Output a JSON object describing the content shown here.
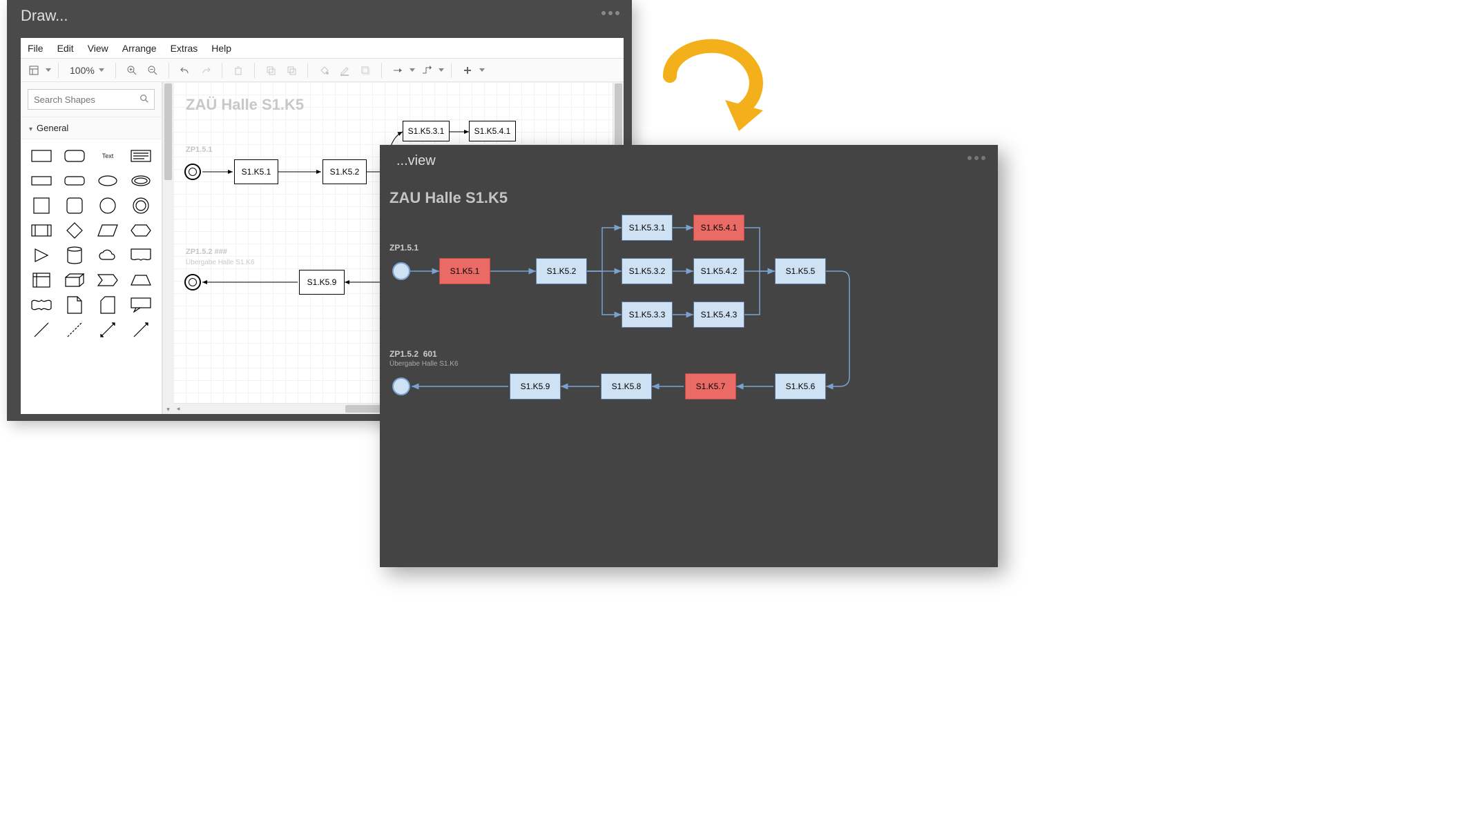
{
  "draw": {
    "title": "Draw...",
    "menubar": [
      "File",
      "Edit",
      "View",
      "Arrange",
      "Extras",
      "Help"
    ],
    "zoom": "100%",
    "search_placeholder": "Search Shapes",
    "palette_section": "General",
    "shape_text_label": "Text",
    "canvas": {
      "title": "ZAÜ Halle S1.K5",
      "zp1": "ZP1.5.1",
      "zp2": "ZP1.5.2   ###",
      "zp2_sub": "Übergabe Halle S1.K6",
      "nodes": {
        "n1": "S1.K5.1",
        "n2": "S1.K5.2",
        "n31": "S1.K5.3.1",
        "n41": "S1.K5.4.1",
        "n9": "S1.K5.9"
      }
    }
  },
  "view": {
    "title": "...view",
    "heading": "ZAU Halle S1.K5",
    "zp1": "ZP1.5.1",
    "zp2": "ZP1.5.2",
    "zp2_num": "601",
    "zp2_sub": "Übergabe Halle S1.K6",
    "nodes": {
      "n1": "S1.K5.1",
      "n2": "S1.K5.2",
      "n31": "S1.K5.3.1",
      "n41": "S1.K5.4.1",
      "n32": "S1.K5.3.2",
      "n42": "S1.K5.4.2",
      "n33": "S1.K5.3.3",
      "n43": "S1.K5.4.3",
      "n5": "S1.K5.5",
      "n6": "S1.K5.6",
      "n7": "S1.K5.7",
      "n8": "S1.K5.8",
      "n9": "S1.K5.9"
    }
  },
  "chart_data": {
    "type": "flow-diagram",
    "title": "ZAU Halle S1.K5",
    "lanes": [
      {
        "label": "ZP1.5.1",
        "sublabel": null
      },
      {
        "label": "ZP1.5.2 601",
        "sublabel": "Übergabe Halle S1.K6"
      }
    ],
    "nodes": [
      {
        "id": "start1",
        "type": "start",
        "lane": 0
      },
      {
        "id": "S1.K5.1",
        "type": "task",
        "lane": 0,
        "status": "alert"
      },
      {
        "id": "S1.K5.2",
        "type": "task",
        "lane": 0,
        "status": "normal"
      },
      {
        "id": "S1.K5.3.1",
        "type": "task",
        "lane": 0,
        "status": "normal"
      },
      {
        "id": "S1.K5.4.1",
        "type": "task",
        "lane": 0,
        "status": "alert"
      },
      {
        "id": "S1.K5.3.2",
        "type": "task",
        "lane": 0,
        "status": "normal"
      },
      {
        "id": "S1.K5.4.2",
        "type": "task",
        "lane": 0,
        "status": "normal"
      },
      {
        "id": "S1.K5.3.3",
        "type": "task",
        "lane": 0,
        "status": "normal"
      },
      {
        "id": "S1.K5.4.3",
        "type": "task",
        "lane": 0,
        "status": "normal"
      },
      {
        "id": "S1.K5.5",
        "type": "task",
        "lane": 0,
        "status": "normal"
      },
      {
        "id": "S1.K5.6",
        "type": "task",
        "lane": 1,
        "status": "normal"
      },
      {
        "id": "S1.K5.7",
        "type": "task",
        "lane": 1,
        "status": "alert"
      },
      {
        "id": "S1.K5.8",
        "type": "task",
        "lane": 1,
        "status": "normal"
      },
      {
        "id": "S1.K5.9",
        "type": "task",
        "lane": 1,
        "status": "normal"
      },
      {
        "id": "end2",
        "type": "end",
        "lane": 1
      }
    ],
    "edges": [
      [
        "start1",
        "S1.K5.1"
      ],
      [
        "S1.K5.1",
        "S1.K5.2"
      ],
      [
        "S1.K5.2",
        "S1.K5.3.1"
      ],
      [
        "S1.K5.2",
        "S1.K5.3.2"
      ],
      [
        "S1.K5.2",
        "S1.K5.3.3"
      ],
      [
        "S1.K5.3.1",
        "S1.K5.4.1"
      ],
      [
        "S1.K5.3.2",
        "S1.K5.4.2"
      ],
      [
        "S1.K5.3.3",
        "S1.K5.4.3"
      ],
      [
        "S1.K5.4.1",
        "S1.K5.5"
      ],
      [
        "S1.K5.4.2",
        "S1.K5.5"
      ],
      [
        "S1.K5.4.3",
        "S1.K5.5"
      ],
      [
        "S1.K5.5",
        "S1.K5.6"
      ],
      [
        "S1.K5.6",
        "S1.K5.7"
      ],
      [
        "S1.K5.7",
        "S1.K5.8"
      ],
      [
        "S1.K5.8",
        "S1.K5.9"
      ],
      [
        "S1.K5.9",
        "end2"
      ]
    ],
    "status_colors": {
      "normal": "#cfe2f3",
      "alert": "#ea6b66"
    }
  }
}
